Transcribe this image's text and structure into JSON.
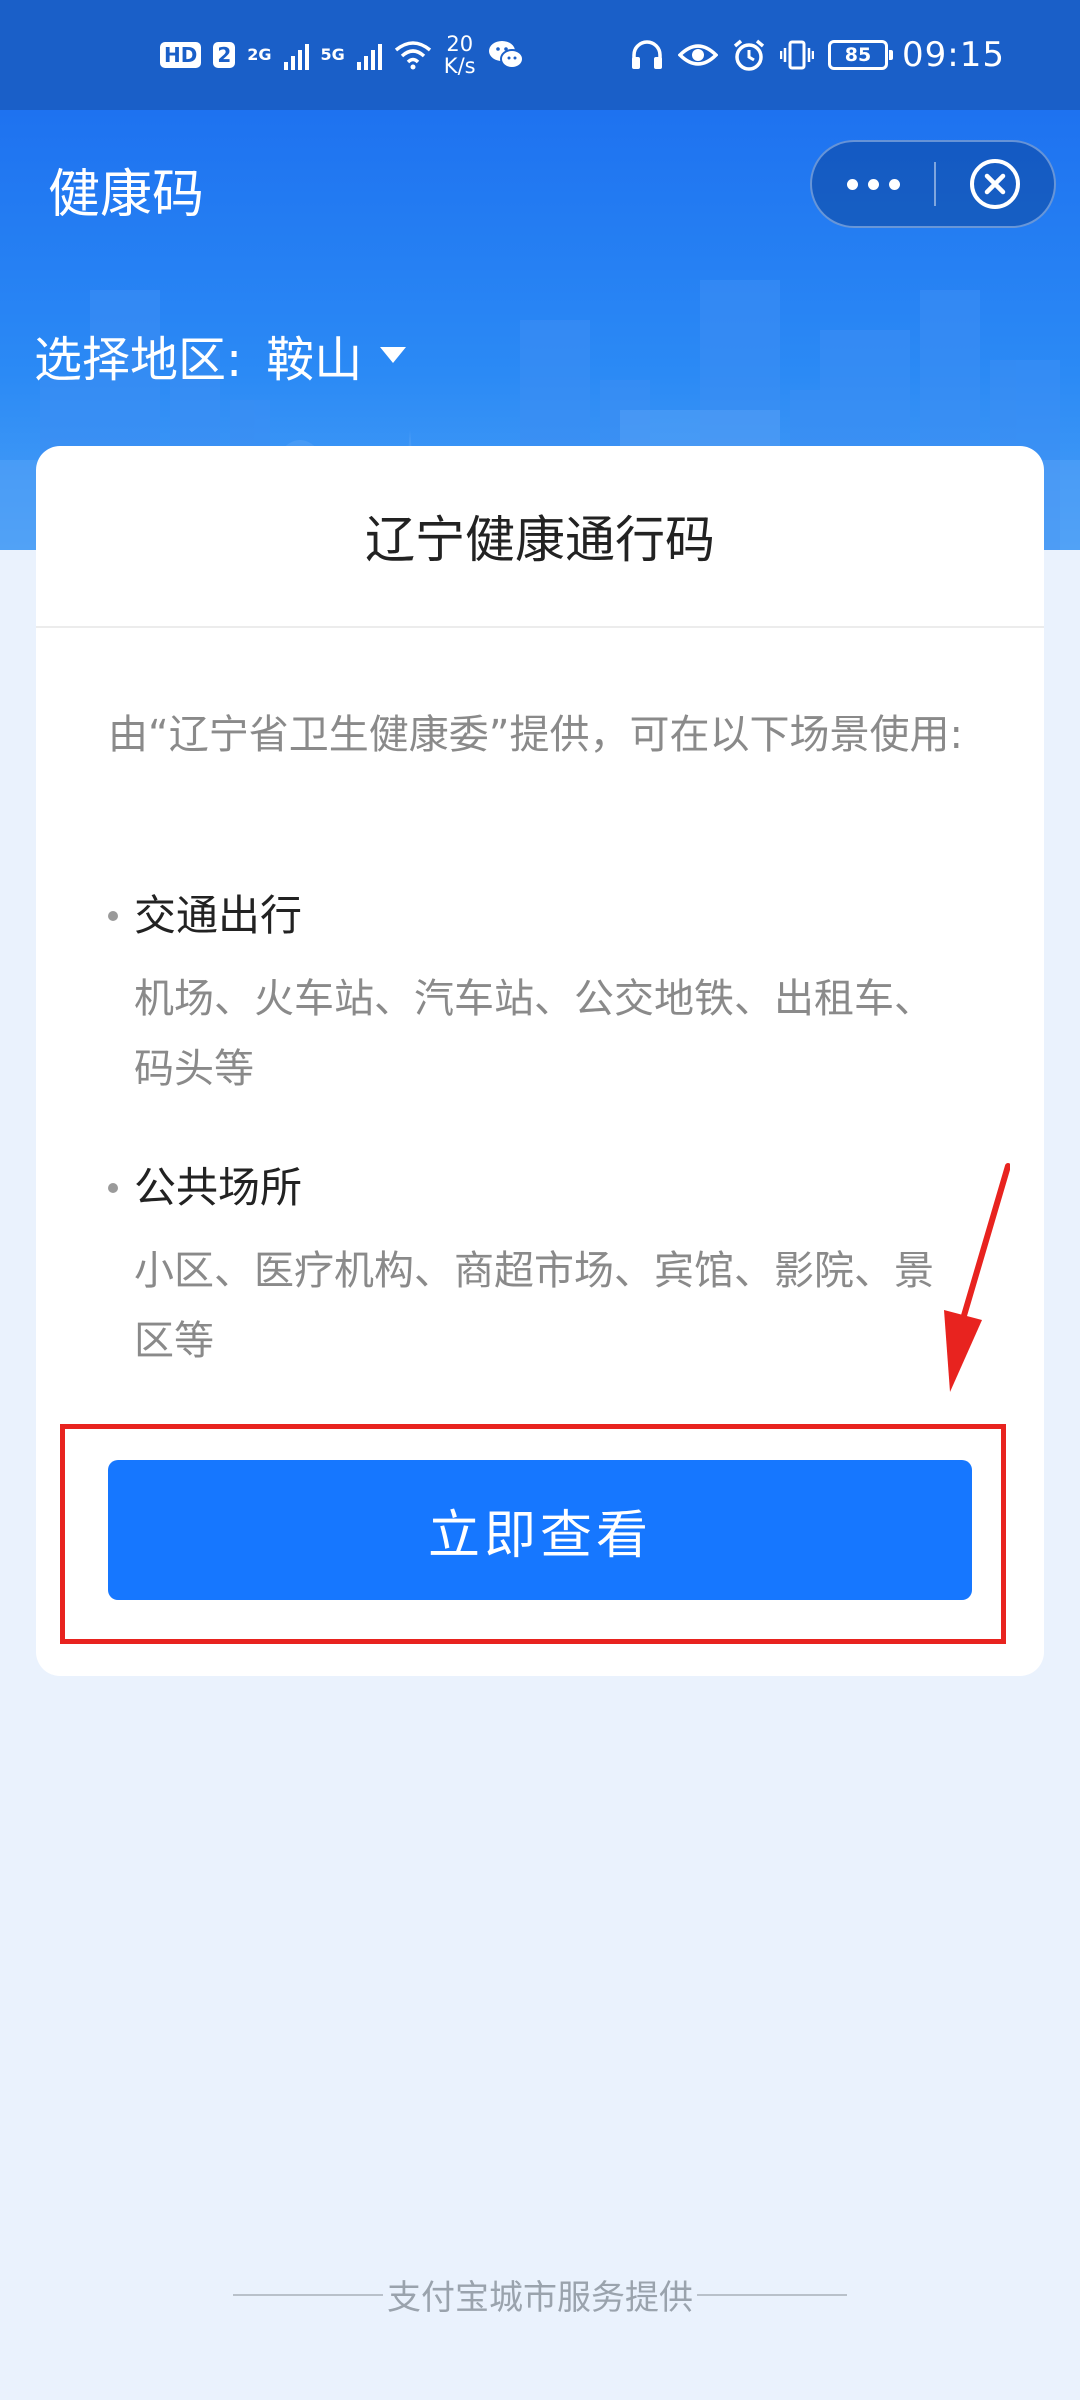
{
  "status_bar": {
    "hd_badge": "HD",
    "sim_badge": "2",
    "net_2g": "2G",
    "net_5g": "5G",
    "speed_value": "20",
    "speed_unit": "K/s",
    "battery": "85",
    "time": "09:15",
    "icons": [
      "headphones-icon",
      "eye-icon",
      "alarm-icon",
      "vibrate-icon",
      "battery-icon",
      "wifi-icon",
      "wechat-icon"
    ]
  },
  "header": {
    "title": "健康码",
    "region_label": "选择地区:",
    "region_value": "鞍山"
  },
  "card": {
    "title": "辽宁健康通行码",
    "intro": "由“辽宁省卫生健康委”提供，可在以下场景使用:",
    "sections": [
      {
        "title": "交通出行",
        "desc": "机场、火车站、汽车站、公交地铁、出租车、码头等"
      },
      {
        "title": "公共场所",
        "desc": "小区、医疗机构、商超市场、宾馆、影院、景区等"
      }
    ],
    "button_label": "立即查看"
  },
  "footer": {
    "text": "支付宝城市服务提供"
  },
  "colors": {
    "status_bar": "#1a5fc8",
    "header_blue": "#1e72f0",
    "button_blue": "#1677ff",
    "page_bg": "#eaf2fd",
    "annotation_red": "#e8231f"
  }
}
